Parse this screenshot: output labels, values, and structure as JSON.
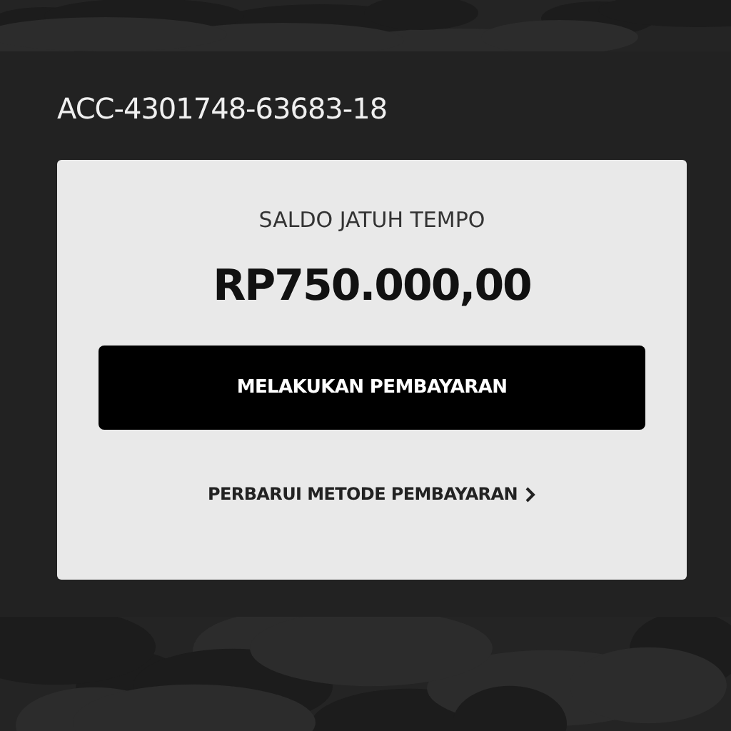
{
  "account": {
    "number": "ACC-4301748-63683-18"
  },
  "card": {
    "label": "SALDO JATUH TEMPO",
    "amount": "RP750.000,00",
    "pay_button": "MELAKUKAN PEMBAYARAN",
    "update_link": "PERBARUI METODE PEMBAYARAN"
  }
}
